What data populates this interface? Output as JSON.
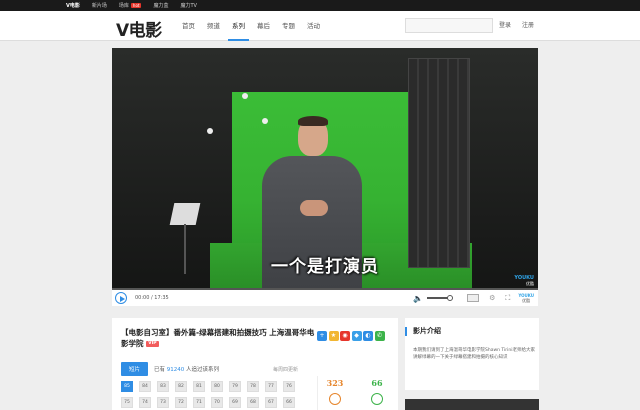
{
  "topbar": {
    "items": [
      {
        "label": "V电影",
        "active": true
      },
      {
        "label": "新片场"
      },
      {
        "label": "场库"
      },
      {
        "label": "魔力盒"
      },
      {
        "label": "魔力TV"
      }
    ],
    "hot_badge": "hot"
  },
  "header": {
    "logo": "V电影",
    "nav": [
      "首页",
      "频道",
      "系列",
      "幕后",
      "专题",
      "活动"
    ],
    "active_nav": "系列",
    "search_placeholder": "",
    "login": "登录",
    "register": "注册"
  },
  "player": {
    "subtitle": "一个是打演员",
    "watermark_brand": "YOUKU",
    "watermark_cn": "优酷",
    "time_current": "00:00",
    "time_total": "17:35",
    "progress": 0.0,
    "volume": 0.85
  },
  "info": {
    "title": "【电影自习室】番外篇-绿幕搭建和拍摄技巧 上海温哥华电影学院",
    "badge": "VIP",
    "tab_active": "短片",
    "has_label": "已有",
    "subscriber_count": "91240",
    "subscriber_suffix": "人追过该系列",
    "update_note": "每周四更新",
    "episodes_row1": [
      "85",
      "84",
      "83",
      "82",
      "81",
      "80",
      "79",
      "78",
      "77",
      "76"
    ],
    "episodes_row2": [
      "75",
      "74",
      "73",
      "72",
      "71",
      "70",
      "69",
      "68",
      "67",
      "66"
    ],
    "vote_up": "323",
    "vote_down": "66"
  },
  "side": {
    "heading": "影片介绍",
    "description": "本期我们请到了上海温哥华电影学院Shawn Tirini老师给大家讲解绿幕的一下关于绿幕搭建和拍摄的核心知识"
  },
  "colors": {
    "accent": "#2f8de4",
    "vote_up": "#e6852b",
    "vote_down": "#3cb34a"
  }
}
